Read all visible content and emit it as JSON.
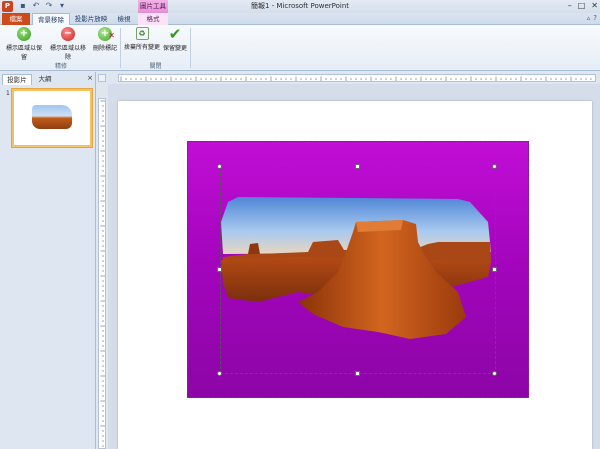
{
  "window": {
    "title": "簡報1 - Microsoft PowerPoint",
    "context_group": "圖片工具",
    "app_icon": "P"
  },
  "tabs": [
    "檔案",
    "背景移除",
    "投影片放映",
    "檢視",
    "格式"
  ],
  "ribbon": {
    "buttons": [
      {
        "label": "標示區域以保留",
        "icon": "plus-circle-icon"
      },
      {
        "label": "標示區域以移除",
        "icon": "minus-circle-icon"
      },
      {
        "label": "刪除標記",
        "icon": "delete-mark-icon"
      },
      {
        "label": "捨棄所有變更",
        "icon": "discard-icon"
      },
      {
        "label": "保留變更",
        "icon": "check-icon"
      }
    ],
    "groups": [
      "精修",
      "關閉"
    ]
  },
  "left_pane": {
    "tabs": [
      "投影片",
      "大綱"
    ],
    "close_label": "×",
    "slide_number": "1"
  },
  "colors": {
    "removal_overlay": "#a004b8",
    "file_tab": "#cf4a1b",
    "selected_thumbnail": "#f2c26b"
  }
}
